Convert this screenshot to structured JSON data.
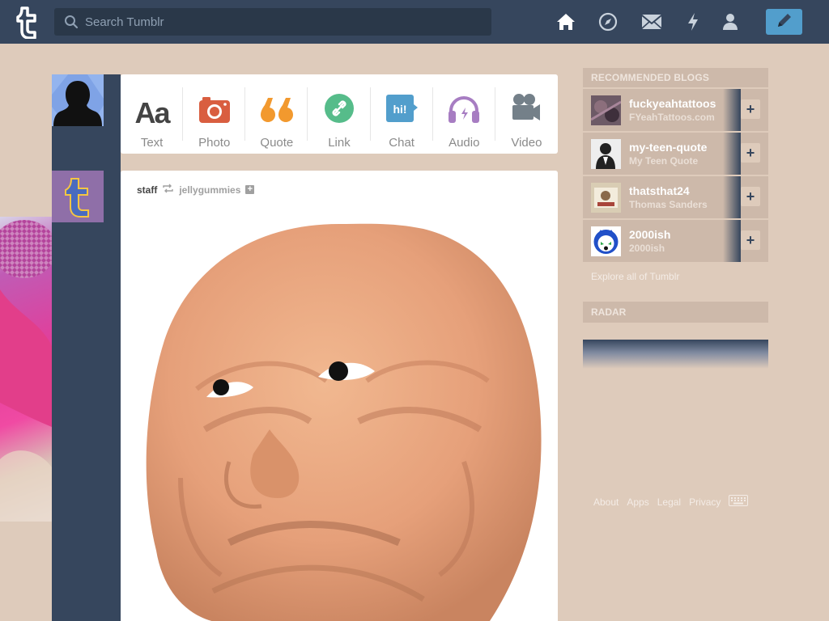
{
  "search": {
    "placeholder": "Search Tumblr"
  },
  "nav": {
    "icons": [
      "home-icon",
      "explore-icon",
      "messages-icon",
      "activity-icon",
      "account-icon"
    ],
    "compose": "pencil-icon"
  },
  "post_types": [
    {
      "label": "Text",
      "icon": "text-icon",
      "color": "#444444"
    },
    {
      "label": "Photo",
      "icon": "camera-icon",
      "color": "#d95e40"
    },
    {
      "label": "Quote",
      "icon": "quote-icon",
      "color": "#f2992e"
    },
    {
      "label": "Link",
      "icon": "link-icon",
      "color": "#56bc8a"
    },
    {
      "label": "Chat",
      "icon": "chat-icon",
      "color": "#529ecc"
    },
    {
      "label": "Audio",
      "icon": "headphones-icon",
      "color": "#a77dc2"
    },
    {
      "label": "Video",
      "icon": "video-camera-icon",
      "color": "#748089"
    }
  ],
  "post": {
    "author": "staff",
    "reblogged_from": "jellygummies"
  },
  "recommended": {
    "heading": "RECOMMENDED BLOGS",
    "blogs": [
      {
        "name": "fuckyeahtattoos",
        "title": "FYeahTattoos.com"
      },
      {
        "name": "my-teen-quote",
        "title": "My Teen Quote"
      },
      {
        "name": "thatsthat24",
        "title": "Thomas Sanders"
      },
      {
        "name": "2000ish",
        "title": "2000ish"
      }
    ],
    "explore": "Explore all of Tumblr"
  },
  "radar": {
    "heading": "RADAR"
  },
  "footer": {
    "links": [
      "About",
      "Apps",
      "Legal",
      "Privacy"
    ]
  },
  "colors": {
    "navy": "#36465d",
    "background": "#decbbb",
    "accent": "#529ecc"
  }
}
